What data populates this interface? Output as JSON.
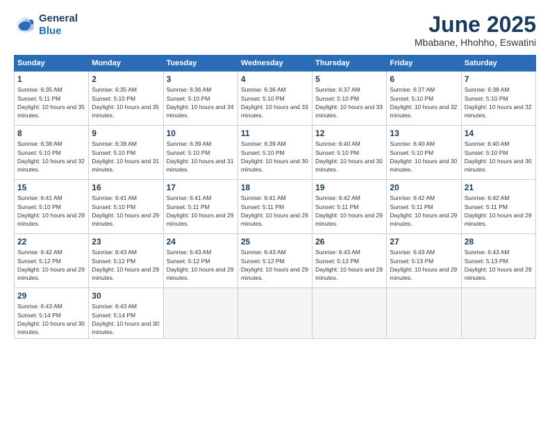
{
  "logo": {
    "line1": "General",
    "line2": "Blue"
  },
  "title": "June 2025",
  "location": "Mbabane, Hhohho, Eswatini",
  "days_header": [
    "Sunday",
    "Monday",
    "Tuesday",
    "Wednesday",
    "Thursday",
    "Friday",
    "Saturday"
  ],
  "weeks": [
    [
      {
        "day": "1",
        "sunrise": "6:35 AM",
        "sunset": "5:11 PM",
        "daylight": "10 hours and 35 minutes."
      },
      {
        "day": "2",
        "sunrise": "6:35 AM",
        "sunset": "5:10 PM",
        "daylight": "10 hours and 35 minutes."
      },
      {
        "day": "3",
        "sunrise": "6:36 AM",
        "sunset": "5:10 PM",
        "daylight": "10 hours and 34 minutes."
      },
      {
        "day": "4",
        "sunrise": "6:36 AM",
        "sunset": "5:10 PM",
        "daylight": "10 hours and 33 minutes."
      },
      {
        "day": "5",
        "sunrise": "6:37 AM",
        "sunset": "5:10 PM",
        "daylight": "10 hours and 33 minutes."
      },
      {
        "day": "6",
        "sunrise": "6:37 AM",
        "sunset": "5:10 PM",
        "daylight": "10 hours and 32 minutes."
      },
      {
        "day": "7",
        "sunrise": "6:38 AM",
        "sunset": "5:10 PM",
        "daylight": "10 hours and 32 minutes."
      }
    ],
    [
      {
        "day": "8",
        "sunrise": "6:38 AM",
        "sunset": "5:10 PM",
        "daylight": "10 hours and 32 minutes."
      },
      {
        "day": "9",
        "sunrise": "6:38 AM",
        "sunset": "5:10 PM",
        "daylight": "10 hours and 31 minutes."
      },
      {
        "day": "10",
        "sunrise": "6:39 AM",
        "sunset": "5:10 PM",
        "daylight": "10 hours and 31 minutes."
      },
      {
        "day": "11",
        "sunrise": "6:39 AM",
        "sunset": "5:10 PM",
        "daylight": "10 hours and 30 minutes."
      },
      {
        "day": "12",
        "sunrise": "6:40 AM",
        "sunset": "5:10 PM",
        "daylight": "10 hours and 30 minutes."
      },
      {
        "day": "13",
        "sunrise": "6:40 AM",
        "sunset": "5:10 PM",
        "daylight": "10 hours and 30 minutes."
      },
      {
        "day": "14",
        "sunrise": "6:40 AM",
        "sunset": "5:10 PM",
        "daylight": "10 hours and 30 minutes."
      }
    ],
    [
      {
        "day": "15",
        "sunrise": "6:41 AM",
        "sunset": "5:10 PM",
        "daylight": "10 hours and 29 minutes."
      },
      {
        "day": "16",
        "sunrise": "6:41 AM",
        "sunset": "5:10 PM",
        "daylight": "10 hours and 29 minutes."
      },
      {
        "day": "17",
        "sunrise": "6:41 AM",
        "sunset": "5:11 PM",
        "daylight": "10 hours and 29 minutes."
      },
      {
        "day": "18",
        "sunrise": "6:41 AM",
        "sunset": "5:11 PM",
        "daylight": "10 hours and 29 minutes."
      },
      {
        "day": "19",
        "sunrise": "6:42 AM",
        "sunset": "5:11 PM",
        "daylight": "10 hours and 29 minutes."
      },
      {
        "day": "20",
        "sunrise": "6:42 AM",
        "sunset": "5:11 PM",
        "daylight": "10 hours and 29 minutes."
      },
      {
        "day": "21",
        "sunrise": "6:42 AM",
        "sunset": "5:11 PM",
        "daylight": "10 hours and 29 minutes."
      }
    ],
    [
      {
        "day": "22",
        "sunrise": "6:42 AM",
        "sunset": "5:12 PM",
        "daylight": "10 hours and 29 minutes."
      },
      {
        "day": "23",
        "sunrise": "6:43 AM",
        "sunset": "5:12 PM",
        "daylight": "10 hours and 29 minutes."
      },
      {
        "day": "24",
        "sunrise": "6:43 AM",
        "sunset": "5:12 PM",
        "daylight": "10 hours and 29 minutes."
      },
      {
        "day": "25",
        "sunrise": "6:43 AM",
        "sunset": "5:12 PM",
        "daylight": "10 hours and 29 minutes."
      },
      {
        "day": "26",
        "sunrise": "6:43 AM",
        "sunset": "5:13 PM",
        "daylight": "10 hours and 29 minutes."
      },
      {
        "day": "27",
        "sunrise": "6:43 AM",
        "sunset": "5:13 PM",
        "daylight": "10 hours and 29 minutes."
      },
      {
        "day": "28",
        "sunrise": "6:43 AM",
        "sunset": "5:13 PM",
        "daylight": "10 hours and 29 minutes."
      }
    ],
    [
      {
        "day": "29",
        "sunrise": "6:43 AM",
        "sunset": "5:14 PM",
        "daylight": "10 hours and 30 minutes."
      },
      {
        "day": "30",
        "sunrise": "6:43 AM",
        "sunset": "5:14 PM",
        "daylight": "10 hours and 30 minutes."
      },
      null,
      null,
      null,
      null,
      null
    ]
  ]
}
